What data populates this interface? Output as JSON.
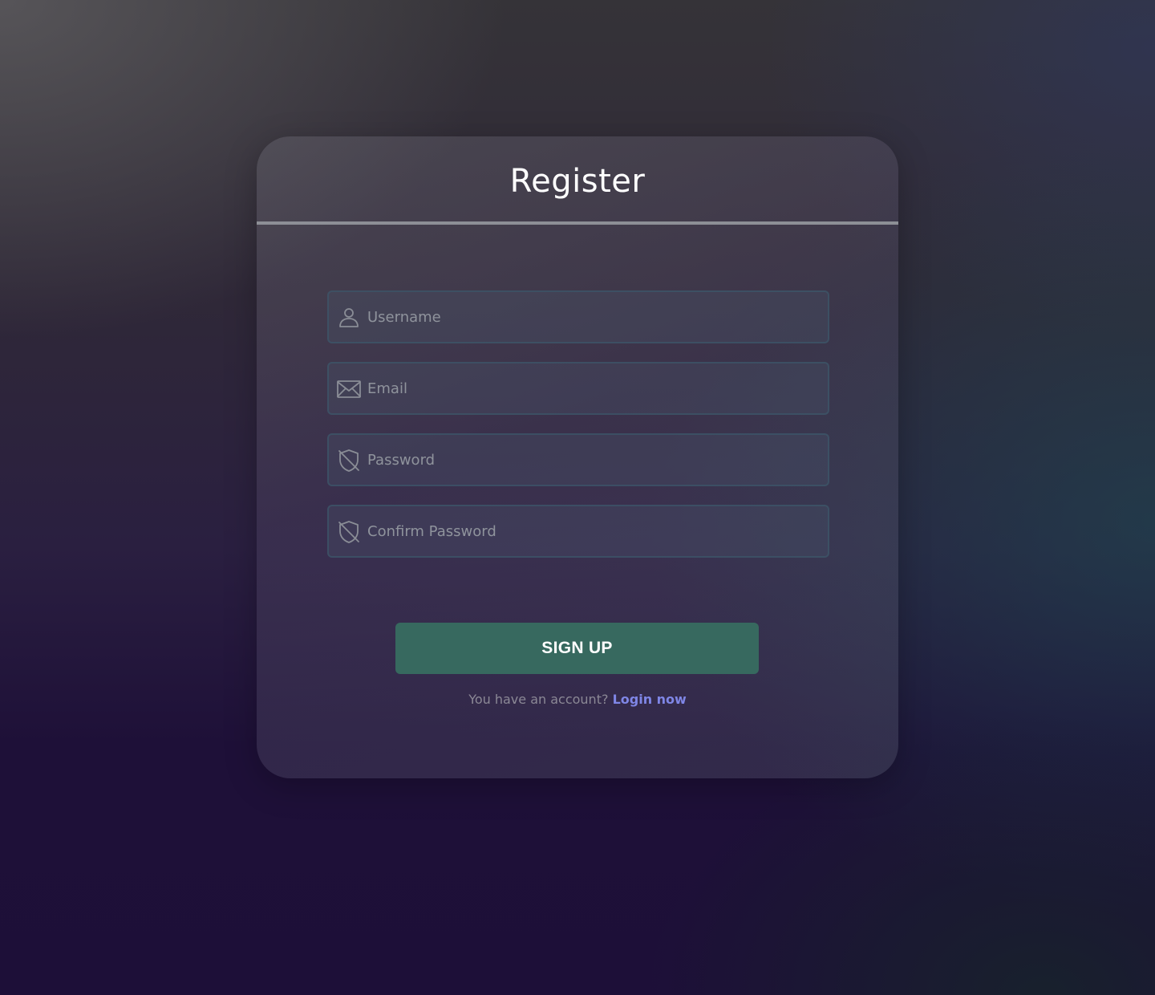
{
  "register": {
    "title": "Register",
    "fields": [
      {
        "icon": "user-icon",
        "placeholder": "Username",
        "value": ""
      },
      {
        "icon": "envelope-icon",
        "placeholder": "Email",
        "value": ""
      },
      {
        "icon": "shield-off-icon",
        "placeholder": "Password",
        "value": ""
      },
      {
        "icon": "shield-off-icon",
        "placeholder": "Confirm Password",
        "value": ""
      }
    ],
    "submit_label": "SIGN UP",
    "login_prompt": "You have an account?",
    "login_link": "Login now"
  },
  "colors": {
    "button": "#37695f",
    "link": "#7f86e6",
    "title": "#ffffff",
    "placeholder": "#8f939c"
  }
}
